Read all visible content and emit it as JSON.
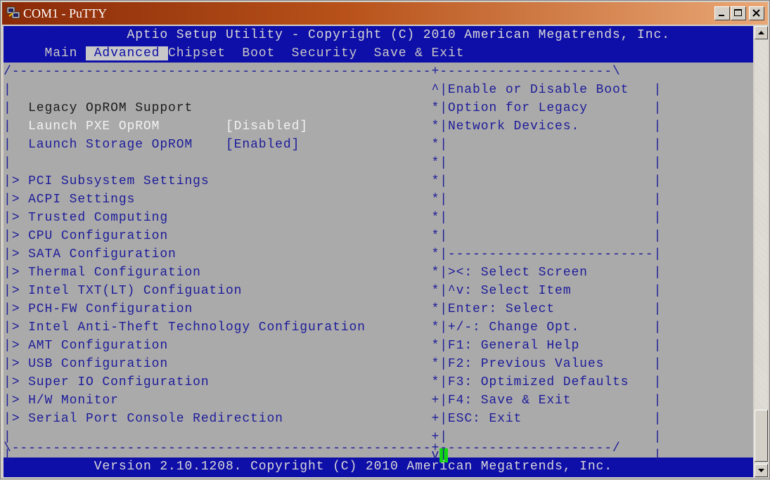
{
  "window": {
    "title": "COM1 - PuTTY"
  },
  "header": {
    "line1": "Aptio Setup Utility - Copyright (C) 2010 American Megatrends, Inc.",
    "tabs": [
      "Main",
      "Advanced",
      "Chipset",
      "Boot",
      "Security",
      "Save & Exit"
    ],
    "active_tab": "Advanced"
  },
  "settings": {
    "legacy_oprom": "Legacy OpROM Support",
    "pxe_label": "Launch PXE OpROM",
    "pxe_value": "[Disabled]",
    "storage_label": "Launch Storage OpROM",
    "storage_value": "[Enabled]"
  },
  "menu_prefix": "> ",
  "menu_items": [
    "PCI Subsystem Settings",
    "ACPI Settings",
    "Trusted Computing",
    "CPU Configuration",
    "SATA Configuration",
    "Thermal Configuration",
    "Intel TXT(LT) Configuation",
    "PCH-FW Configuration",
    "Intel Anti-Theft Technology Configuration",
    "AMT Configuration",
    "USB Configuration",
    "Super IO Configuration",
    "H/W Monitor",
    "Serial Port Console Redirection"
  ],
  "help": {
    "lines": [
      "Enable or Disable Boot",
      "Option for Legacy",
      "Network Devices."
    ]
  },
  "keys": [
    "><: Select Screen",
    "^v: Select Item",
    "Enter: Select",
    "+/-: Change Opt.",
    "F1: General Help",
    "F2: Previous Values",
    "F3: Optimized Defaults",
    "F4: Save & Exit",
    "ESC: Exit"
  ],
  "scroll_marks": [
    "^",
    "*",
    "*",
    "*",
    "*",
    "*",
    "*",
    "*",
    "*",
    "*",
    "*",
    "*",
    "*",
    "*",
    "*",
    "*",
    "*",
    "+",
    "+",
    "+",
    "v"
  ],
  "footer": {
    "text": "Version 2.10.1208. Copyright (C) 2010 American Megatrends, Inc."
  }
}
